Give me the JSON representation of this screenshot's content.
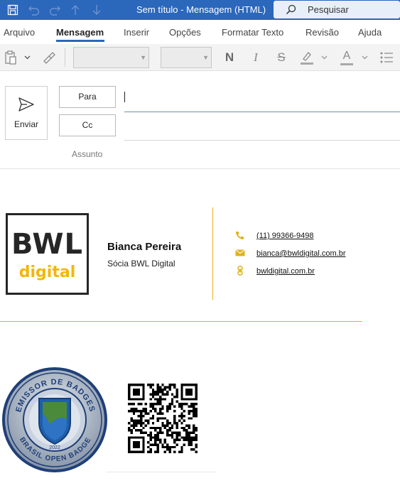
{
  "titlebar": {
    "title": "Sem título  -  Mensagem (HTML)",
    "search_placeholder": "Pesquisar",
    "icons": [
      "save-icon",
      "undo-icon",
      "redo-icon",
      "arrow-up-icon",
      "arrow-down-icon",
      "search-icon"
    ]
  },
  "menu": {
    "items": [
      "Arquivo",
      "Mensagem",
      "Inserir",
      "Opções",
      "Formatar Texto",
      "Revisão",
      "Ajuda"
    ],
    "active": "Mensagem"
  },
  "ribbon": {
    "bold_glyph": "N",
    "italic_glyph": "I",
    "strike_glyph": "S",
    "font_color_glyph": "A",
    "highlight_color": "#f2b705",
    "font_color": "#c00000"
  },
  "compose": {
    "send_label": "Enviar",
    "to_label": "Para",
    "cc_label": "Cc",
    "subject_label": "Assunto"
  },
  "signature": {
    "logo_line1": "BWL",
    "logo_line2": "digital",
    "name": "Bianca Pereira",
    "role": "Sócia BWL Digital",
    "phone": "(11) 99366-9498",
    "email": "bianca@bwldigital.com.br",
    "website": "bwldigital.com.br",
    "accent_color": "#e0b21d"
  },
  "badge": {
    "top_text": "EMISSOR DE BADGES",
    "bottom_text": "BRASIL OPEN BADGE",
    "year": "2022"
  }
}
